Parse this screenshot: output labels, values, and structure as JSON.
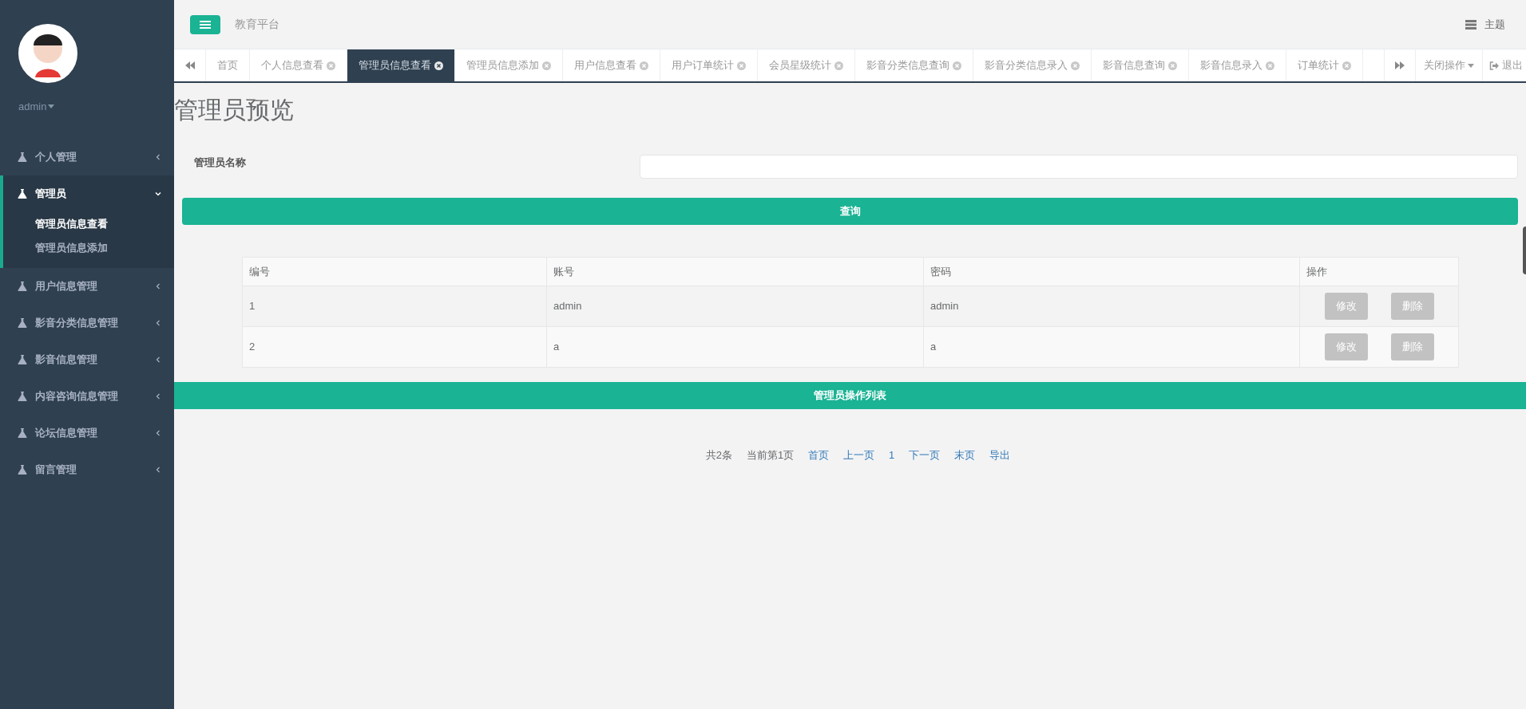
{
  "sidebar": {
    "user": "admin",
    "menu": [
      {
        "label": "个人管理",
        "expanded": false
      },
      {
        "label": "管理员",
        "expanded": true,
        "children": [
          {
            "label": "管理员信息查看",
            "selected": true
          },
          {
            "label": "管理员信息添加",
            "selected": false
          }
        ]
      },
      {
        "label": "用户信息管理",
        "expanded": false
      },
      {
        "label": "影音分类信息管理",
        "expanded": false
      },
      {
        "label": "影音信息管理",
        "expanded": false
      },
      {
        "label": "内容咨询信息管理",
        "expanded": false
      },
      {
        "label": "论坛信息管理",
        "expanded": false
      },
      {
        "label": "留言管理",
        "expanded": false
      }
    ]
  },
  "header": {
    "title": "教育平台",
    "theme": "主题"
  },
  "tabs": [
    {
      "label": "首页",
      "closable": false,
      "selected": false
    },
    {
      "label": "个人信息查看",
      "closable": true,
      "selected": false
    },
    {
      "label": "管理员信息查看",
      "closable": true,
      "selected": true
    },
    {
      "label": "管理员信息添加",
      "closable": true,
      "selected": false
    },
    {
      "label": "用户信息查看",
      "closable": true,
      "selected": false
    },
    {
      "label": "用户订单统计",
      "closable": true,
      "selected": false
    },
    {
      "label": "会员星级统计",
      "closable": true,
      "selected": false
    },
    {
      "label": "影音分类信息查询",
      "closable": true,
      "selected": false
    },
    {
      "label": "影音分类信息录入",
      "closable": true,
      "selected": false
    },
    {
      "label": "影音信息查询",
      "closable": true,
      "selected": false
    },
    {
      "label": "影音信息录入",
      "closable": true,
      "selected": false
    },
    {
      "label": "订单统计",
      "closable": true,
      "selected": false
    }
  ],
  "tab_actions": {
    "close": "关闭操作",
    "logout": "退出"
  },
  "page": {
    "title": "管理员预览",
    "filter_label": "管理员名称",
    "query_button": "查询",
    "table": {
      "columns": [
        "编号",
        "账号",
        "密码",
        "操作"
      ],
      "rows": [
        {
          "cells": [
            "1",
            "admin",
            "admin"
          ],
          "actions": [
            "修改",
            "删除"
          ]
        },
        {
          "cells": [
            "2",
            "a",
            "a"
          ],
          "actions": [
            "修改",
            "删除"
          ]
        }
      ]
    },
    "list_bar": "管理员操作列表",
    "pagination": {
      "total": "共2条",
      "current": "当前第1页",
      "links": [
        "首页",
        "上一页",
        "1",
        "下一页",
        "末页",
        "导出"
      ]
    }
  }
}
